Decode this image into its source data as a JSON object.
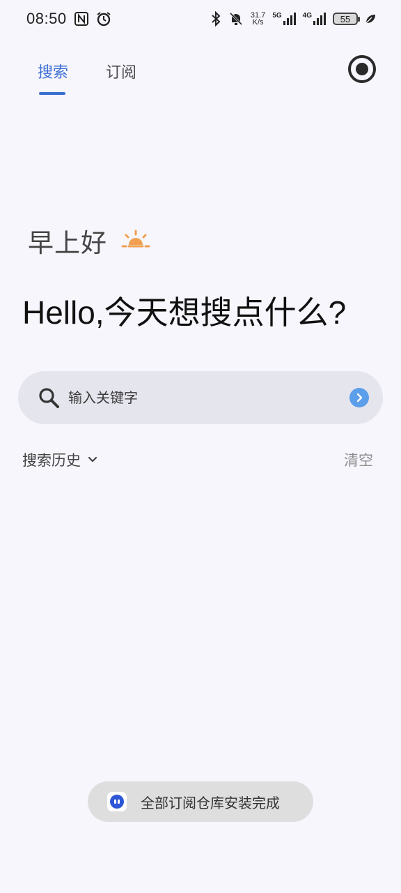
{
  "status_bar": {
    "time": "08:50",
    "icons": [
      "nfc-icon",
      "alarm-icon",
      "bluetooth-icon",
      "mute-icon"
    ],
    "speed_value": "31.7",
    "speed_unit": "K/s",
    "network_1": "5G",
    "network_2": "4G",
    "battery": "55"
  },
  "tabs": [
    {
      "label": "搜索",
      "active": true
    },
    {
      "label": "订阅",
      "active": false
    }
  ],
  "greeting": {
    "text": "早上好",
    "icon": "sunrise-icon"
  },
  "headline": "Hello,今天想搜点什么?",
  "search": {
    "placeholder": "输入关键字",
    "value": ""
  },
  "history": {
    "label": "搜索历史",
    "clear": "清空"
  },
  "toast": {
    "text": "全部订阅仓库安装完成"
  },
  "colors": {
    "accent": "#3d6fd3",
    "background": "#f7f6fd",
    "search_bg": "#e5e5ee",
    "go_button": "#5b9ee9",
    "sun": "#f0a050"
  }
}
